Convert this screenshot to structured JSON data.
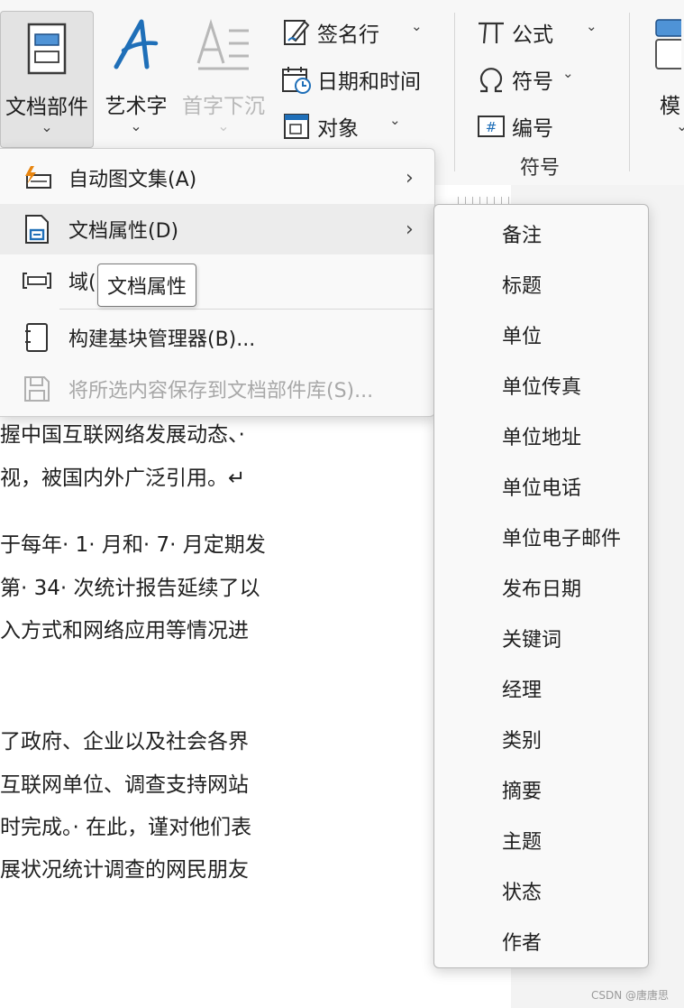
{
  "ribbon": {
    "doc_parts_label": "文档部件",
    "wordart_label": "艺术字",
    "dropcap_label": "首字下沉",
    "template_label": "模",
    "signature_line_label": "签名行",
    "date_time_label": "日期和时间",
    "object_label": "对象",
    "equation_label": "公式",
    "symbol_label": "符号",
    "number_label": "编号",
    "symbols_group_label": "符号",
    "chevron": "⌄",
    "small_chevron": "⌄"
  },
  "doc_parts_menu": {
    "items": [
      {
        "label": "自动图文集(A)",
        "icon": "autotext-icon",
        "has_submenu": true
      },
      {
        "label": "文档属性(D)",
        "icon": "document-property-icon",
        "has_submenu": true
      },
      {
        "label": "域(",
        "icon": "field-icon",
        "has_submenu": false
      },
      {
        "label": "构建基块管理器(B)...",
        "icon": "building-blocks-icon",
        "has_submenu": false
      },
      {
        "label": "将所选内容保存到文档部件库(S)...",
        "icon": "save-selection-icon",
        "has_submenu": false,
        "disabled": true
      }
    ],
    "arrow": "›"
  },
  "tooltip": {
    "text": "文档属性"
  },
  "property_submenu": {
    "items": [
      "备注",
      "标题",
      "单位",
      "单位传真",
      "单位地址",
      "单位电话",
      "单位电子邮件",
      "发布日期",
      "关键词",
      "经理",
      "类别",
      "摘要",
      "主题",
      "状态",
      "作者"
    ]
  },
  "document": {
    "lines": [
      "握中国互联网络发展动态、·",
      "视，被国内外广泛引用。↵",
      "于每年· 1· 月和· 7· 月定期发",
      "第· 34· 次统计报告延续了以",
      "入方式和网络应用等情况进",
      "了政府、企业以及社会各界",
      "互联网单位、调查支持网站",
      "时完成。· 在此，谨对他们表",
      "展状况统计调查的网民朋友"
    ]
  },
  "watermark": "CSDN @唐唐思",
  "colors": {
    "accent_blue": "#1f6fb8",
    "icon_orange": "#e8850f",
    "disabled_gray": "#a8a8a8"
  }
}
